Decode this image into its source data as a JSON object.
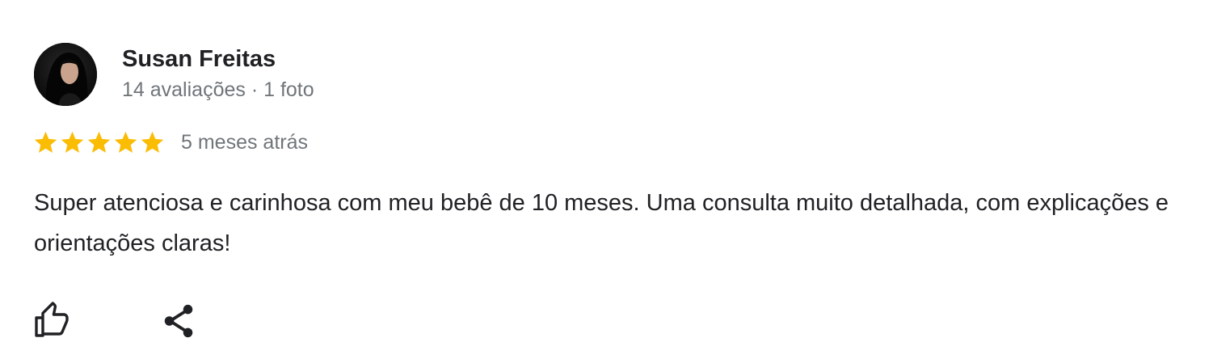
{
  "review": {
    "author": {
      "name": "Susan Freitas",
      "meta": "14 avaliações · 1 foto",
      "avatar_icon": "profile-photo"
    },
    "rating": {
      "stars": 5,
      "max_stars": 5,
      "star_color": "#fbbc04"
    },
    "date": "5 meses atrás",
    "text": "Super atenciosa e carinhosa com meu bebê de 10 meses. Uma consulta muito detalhada, com explicações e orientações claras!",
    "actions": [
      {
        "name": "like",
        "icon": "thumbs-up-icon"
      },
      {
        "name": "share",
        "icon": "share-icon"
      }
    ]
  }
}
